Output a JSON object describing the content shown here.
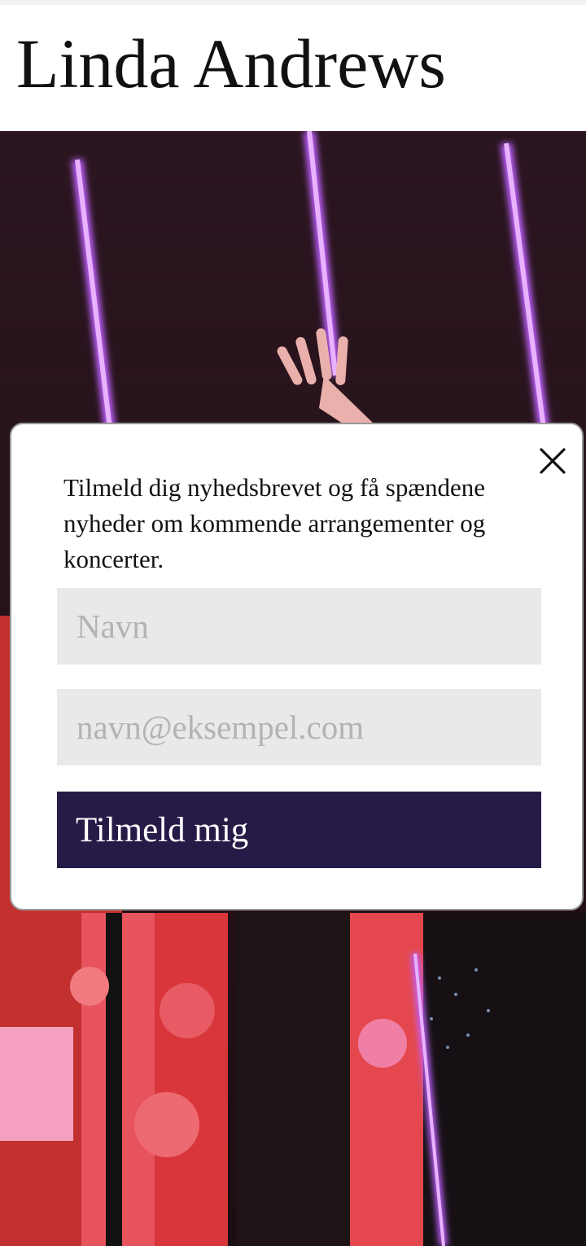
{
  "site": {
    "title": "Linda Andrews"
  },
  "hero": {
    "description_icon": "concert-photo"
  },
  "newsletter_modal": {
    "text": "Tilmeld dig nyhedsbrevet og få spændene nyheder om kommende arrangementer og koncerter.",
    "name_placeholder": "Navn",
    "name_value": "",
    "email_placeholder": "navn@eksempel.com",
    "email_value": "",
    "submit_label": "Tilmeld mig",
    "close_icon": "close-icon"
  },
  "colors": {
    "button_bg": "#261b47",
    "button_text": "#ffffff",
    "input_bg": "#e9e9e9",
    "placeholder": "#b3b3b3",
    "modal_border": "#9a9a9a"
  }
}
